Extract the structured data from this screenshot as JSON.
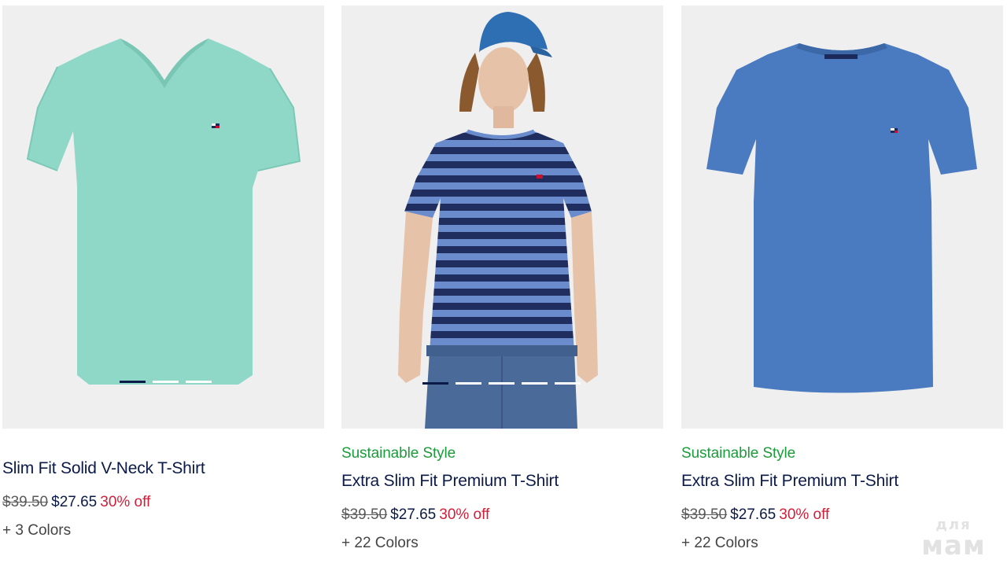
{
  "products": [
    {
      "name": "Slim Fit Solid V-Neck T-Shirt",
      "promo": "",
      "original_price": "$39.50",
      "sale_price": "$27.65",
      "discount": "30% off",
      "colors": "+ 3 Colors",
      "image_slides": 3,
      "active_slide": 1,
      "shirt_color": "#8fd8c8"
    },
    {
      "name": "Extra Slim Fit Premium T-Shirt",
      "promo": "Sustainable Style",
      "original_price": "$39.50",
      "sale_price": "$27.65",
      "discount": "30% off",
      "colors": "+ 22 Colors",
      "image_slides": 5,
      "active_slide": 1,
      "shirt_color": "#2b3f78"
    },
    {
      "name": "Extra Slim Fit Premium T-Shirt",
      "promo": "Sustainable Style",
      "original_price": "$39.50",
      "sale_price": "$27.65",
      "discount": "30% off",
      "colors": "+ 22 Colors",
      "image_slides": 0,
      "active_slide": 0,
      "shirt_color": "#4a7ac0"
    }
  ],
  "colors": {
    "promo_green": "#1c9b3a",
    "discount_red": "#d01e39",
    "navy": "#0b1a46",
    "image_bg": "#efefef"
  },
  "watermark": {
    "line1": "для",
    "line2": "мам"
  }
}
